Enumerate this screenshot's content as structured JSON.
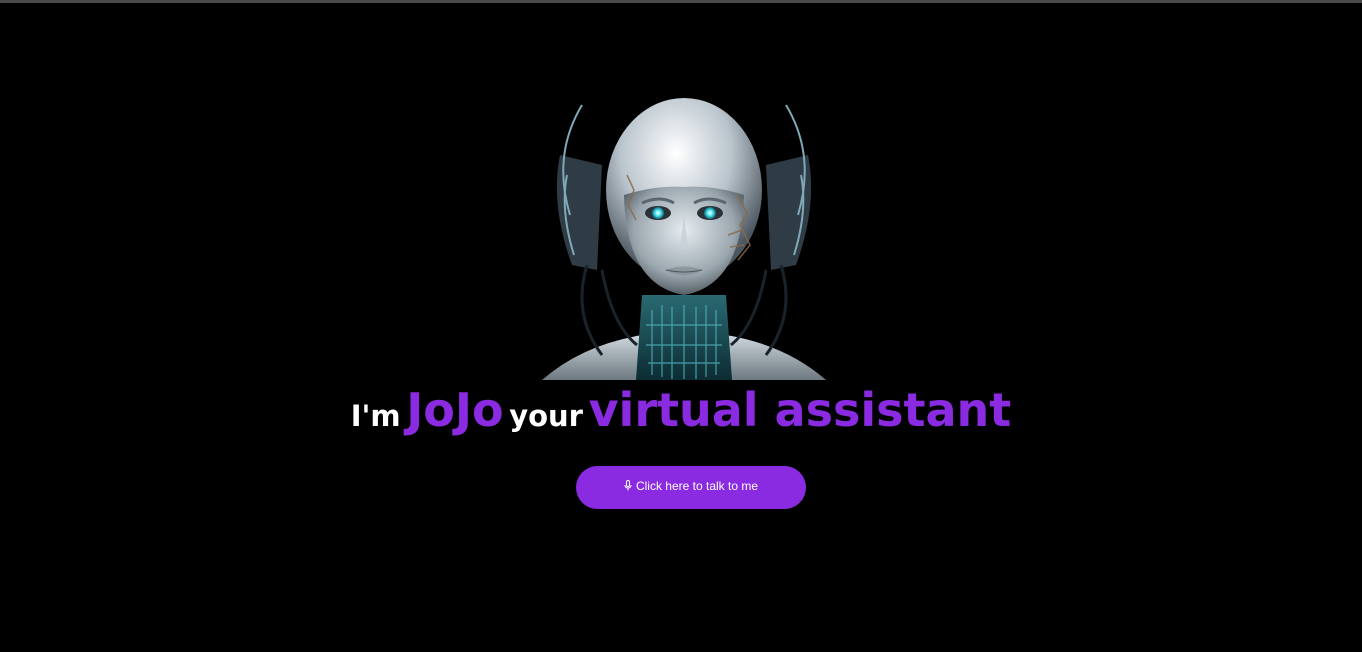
{
  "hero": {
    "avatar_icon": "robot-assistant-portrait-icon",
    "headline": {
      "part1": "I'm",
      "part2": "JoJo",
      "part3": "your",
      "part4": "virtual assistant"
    },
    "talk_button": {
      "icon": "microphone-icon",
      "label": "Click here to talk to me"
    }
  },
  "colors": {
    "background": "#000000",
    "accent": "#8a2be2",
    "text": "#ffffff"
  }
}
